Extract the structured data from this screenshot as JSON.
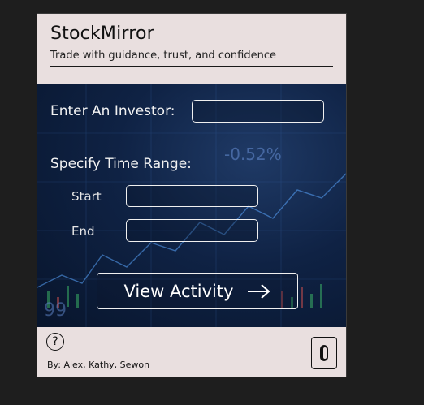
{
  "app": {
    "title": "StockMirror",
    "tagline": "Trade with guidance, trust, and confidence"
  },
  "form": {
    "investor_label": "Enter An Investor:",
    "investor_value": "",
    "time_range_label": "Specify Time Range:",
    "start_label": "Start",
    "start_value": "",
    "end_label": "End",
    "end_value": "",
    "submit_label": "View Activity"
  },
  "background": {
    "ticker_text_1": "-0.52%",
    "ticker_text_2": "99"
  },
  "footer": {
    "help_symbol": "?",
    "authors": "By: Alex, Kathy, Sewon"
  },
  "colors": {
    "header_bg": "#e9dfdf",
    "panel_bg": "#0f2244",
    "text_light": "#f2f2f2",
    "page_bg": "#1e1e1e"
  },
  "icons": {
    "submit": "arrow-right-icon",
    "help": "question-circle-icon",
    "toggle": "toggle-switch-icon"
  }
}
